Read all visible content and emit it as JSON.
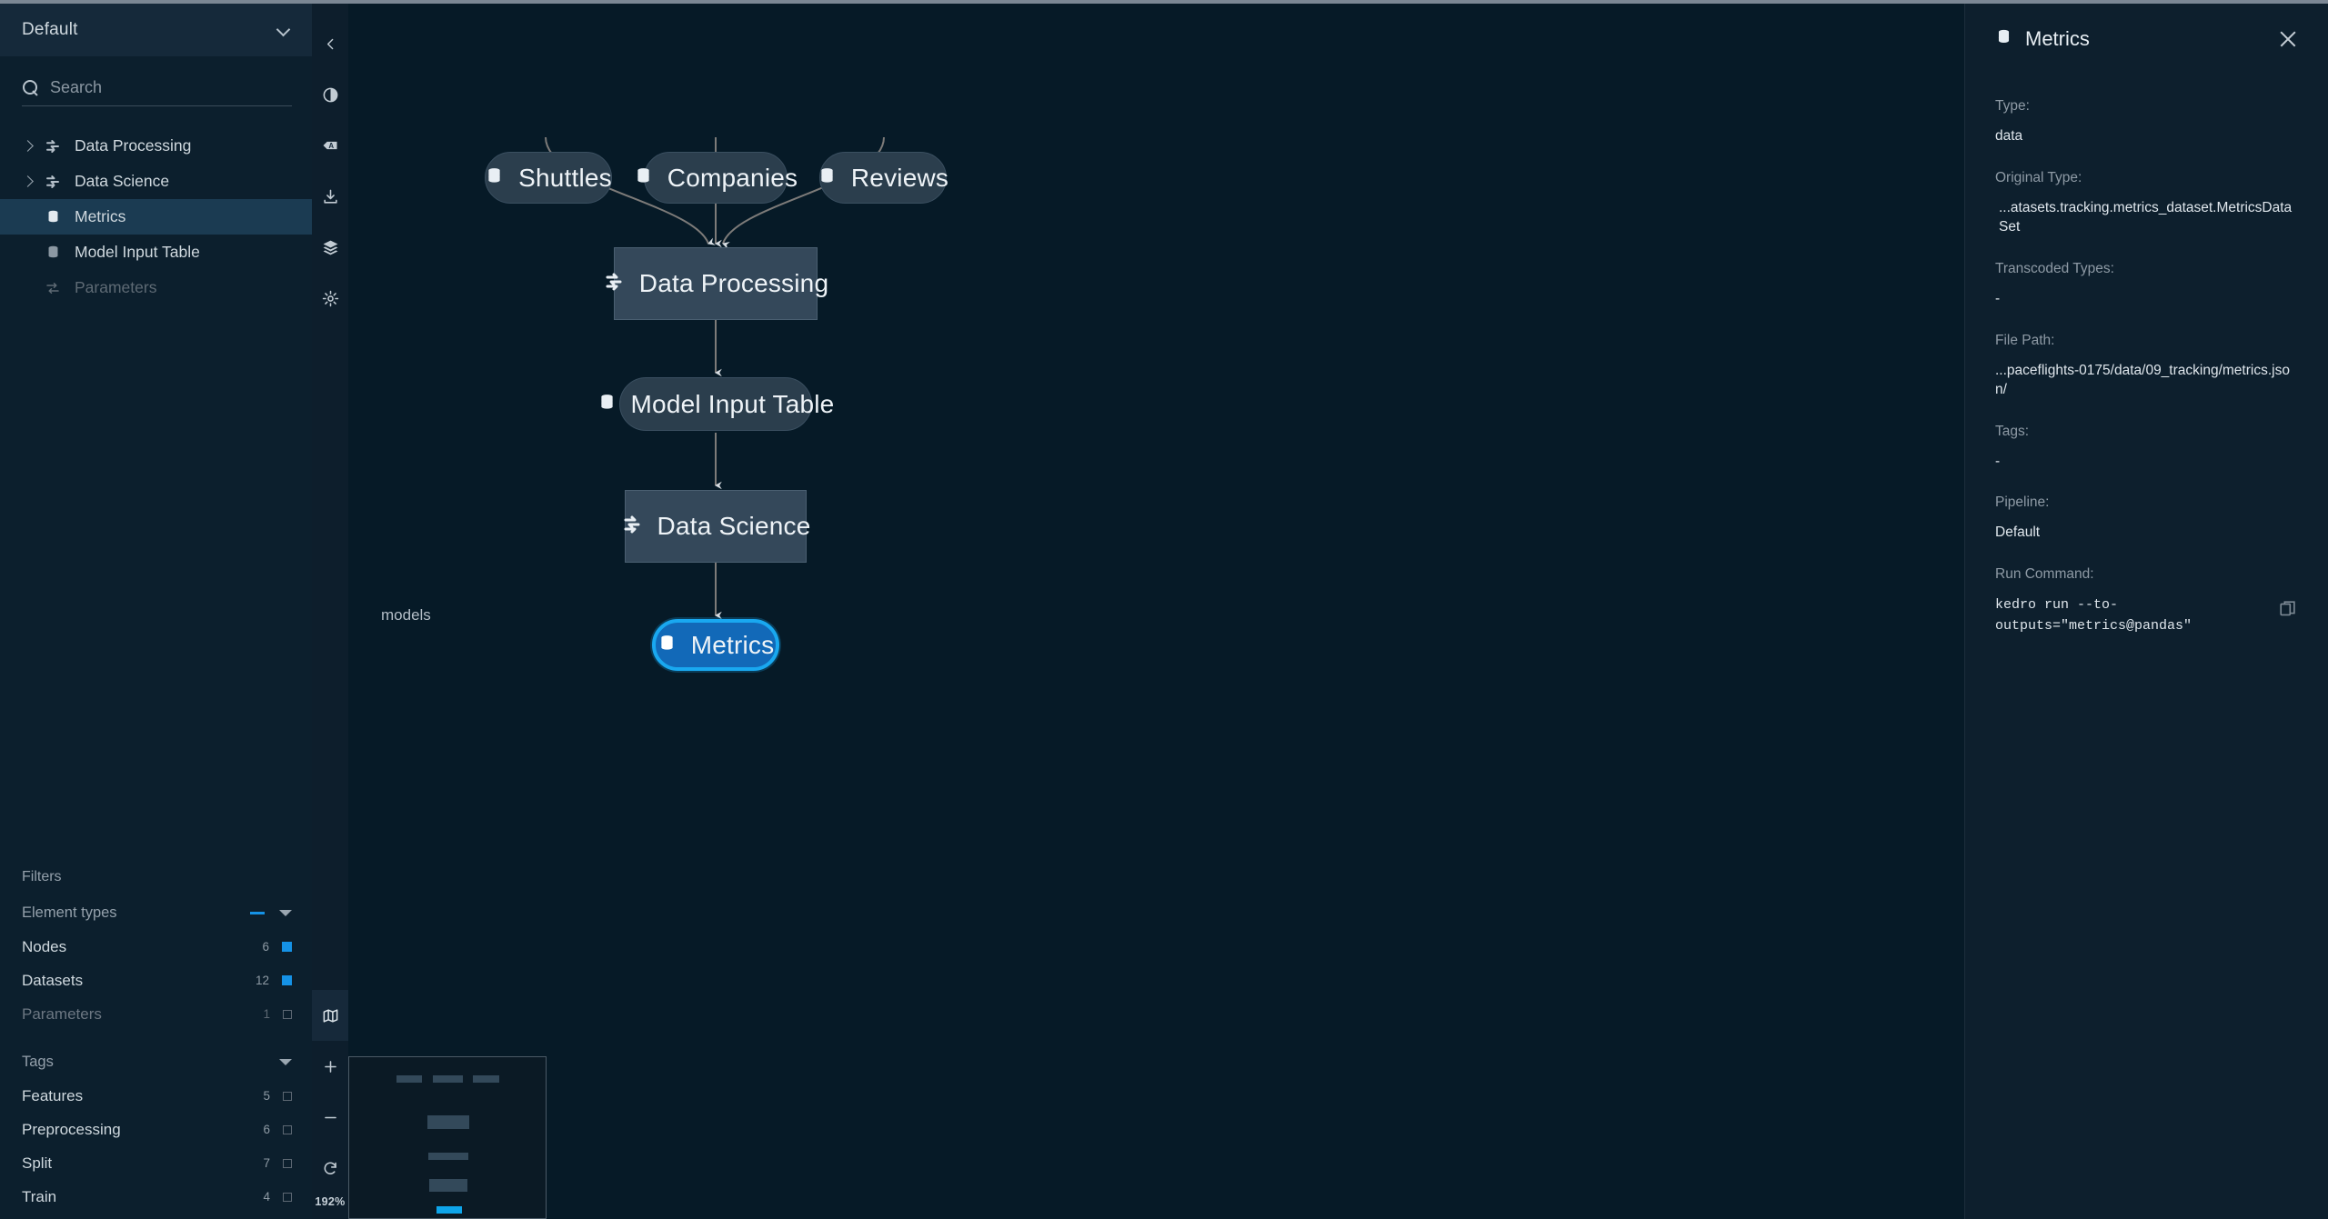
{
  "sidebar": {
    "pipeline_selector": {
      "value": "Default",
      "icon": "chevron-down-icon"
    },
    "search": {
      "placeholder": "Search",
      "value": "",
      "icon": "search-icon"
    },
    "tree": [
      {
        "label": "Data Processing",
        "icon": "pipeline-icon",
        "expandable": true,
        "selected": false,
        "disabled": false
      },
      {
        "label": "Data Science",
        "icon": "pipeline-icon",
        "expandable": true,
        "selected": false,
        "disabled": false
      },
      {
        "label": "Metrics",
        "icon": "dataset-icon",
        "expandable": false,
        "selected": true,
        "disabled": false
      },
      {
        "label": "Model Input Table",
        "icon": "dataset-icon",
        "expandable": false,
        "selected": false,
        "disabled": false
      },
      {
        "label": "Parameters",
        "icon": "parameters-icon",
        "expandable": false,
        "selected": false,
        "disabled": true
      }
    ],
    "filters": {
      "title": "Filters",
      "groups": [
        {
          "name": "Element types",
          "state": "indeterminate",
          "rows": [
            {
              "label": "Nodes",
              "count": "6",
              "checked": true,
              "dimmed": false
            },
            {
              "label": "Datasets",
              "count": "12",
              "checked": true,
              "dimmed": false
            },
            {
              "label": "Parameters",
              "count": "1",
              "checked": false,
              "dimmed": true
            }
          ]
        },
        {
          "name": "Tags",
          "state": "collapsedToggle",
          "rows": [
            {
              "label": "Features",
              "count": "5",
              "checked": false,
              "dimmed": false
            },
            {
              "label": "Preprocessing",
              "count": "6",
              "checked": false,
              "dimmed": false
            },
            {
              "label": "Split",
              "count": "7",
              "checked": false,
              "dimmed": false
            },
            {
              "label": "Train",
              "count": "4",
              "checked": false,
              "dimmed": false
            }
          ]
        }
      ]
    }
  },
  "rail": {
    "top": [
      {
        "name": "collapse-sidebar-icon"
      },
      {
        "name": "theme-toggle-icon"
      },
      {
        "name": "text-labels-toggle-icon"
      },
      {
        "name": "export-icon"
      },
      {
        "name": "layers-icon"
      },
      {
        "name": "settings-gear-icon"
      }
    ],
    "bottom": [
      {
        "name": "minimap-toggle-icon",
        "active": true
      },
      {
        "name": "zoom-in-icon",
        "active": false
      },
      {
        "name": "zoom-out-icon",
        "active": false
      },
      {
        "name": "reset-zoom-icon",
        "active": false
      }
    ],
    "zoom_level": "192%"
  },
  "canvas": {
    "namespace_label": "models",
    "nodes": [
      {
        "id": "shuttles",
        "label": "Shuttles",
        "type": "data",
        "icon": "dataset-icon",
        "selected": false
      },
      {
        "id": "companies",
        "label": "Companies",
        "type": "data",
        "icon": "dataset-icon",
        "selected": false
      },
      {
        "id": "reviews",
        "label": "Reviews",
        "type": "data",
        "icon": "dataset-icon",
        "selected": false
      },
      {
        "id": "data-processing",
        "label": "Data Processing",
        "type": "task",
        "icon": "pipeline-icon",
        "selected": false
      },
      {
        "id": "model-input-table",
        "label": "Model Input Table",
        "type": "data",
        "icon": "dataset-icon",
        "selected": false
      },
      {
        "id": "data-science",
        "label": "Data Science",
        "type": "task",
        "icon": "pipeline-icon",
        "selected": false
      },
      {
        "id": "metrics",
        "label": "Metrics",
        "type": "data",
        "icon": "dataset-icon",
        "selected": true
      }
    ],
    "edges": [
      {
        "from": "shuttles",
        "to": "data-processing"
      },
      {
        "from": "companies",
        "to": "data-processing"
      },
      {
        "from": "reviews",
        "to": "data-processing"
      },
      {
        "from": "data-processing",
        "to": "model-input-table"
      },
      {
        "from": "model-input-table",
        "to": "data-science"
      },
      {
        "from": "data-science",
        "to": "metrics"
      }
    ]
  },
  "metadata": {
    "title": "Metrics",
    "icon": "dataset-icon",
    "close_icon": "close-icon",
    "fields": [
      {
        "key": "Type:",
        "value": "data"
      },
      {
        "key": "Original Type:",
        "value": "...atasets.tracking.metrics_dataset.MetricsDataSet"
      },
      {
        "key": "Transcoded Types:",
        "value": "-"
      },
      {
        "key": "File Path:",
        "value": "...paceflights-0175/data/09_tracking/metrics.json/"
      },
      {
        "key": "Tags:",
        "value": "-"
      },
      {
        "key": "Pipeline:",
        "value": "Default"
      }
    ],
    "run_command": {
      "key": "Run Command:",
      "value": "kedro run --to-outputs=\"metrics@pandas\"",
      "copy_icon": "copy-icon"
    }
  },
  "colors": {
    "accent": "#1592e6",
    "selected_node_fill": "#1269b8",
    "selected_node_border": "#19a8f0",
    "canvas_bg": "#061a27",
    "sidebar_bg": "#0c1f2d",
    "panel_bg": "#0d1f2d"
  }
}
